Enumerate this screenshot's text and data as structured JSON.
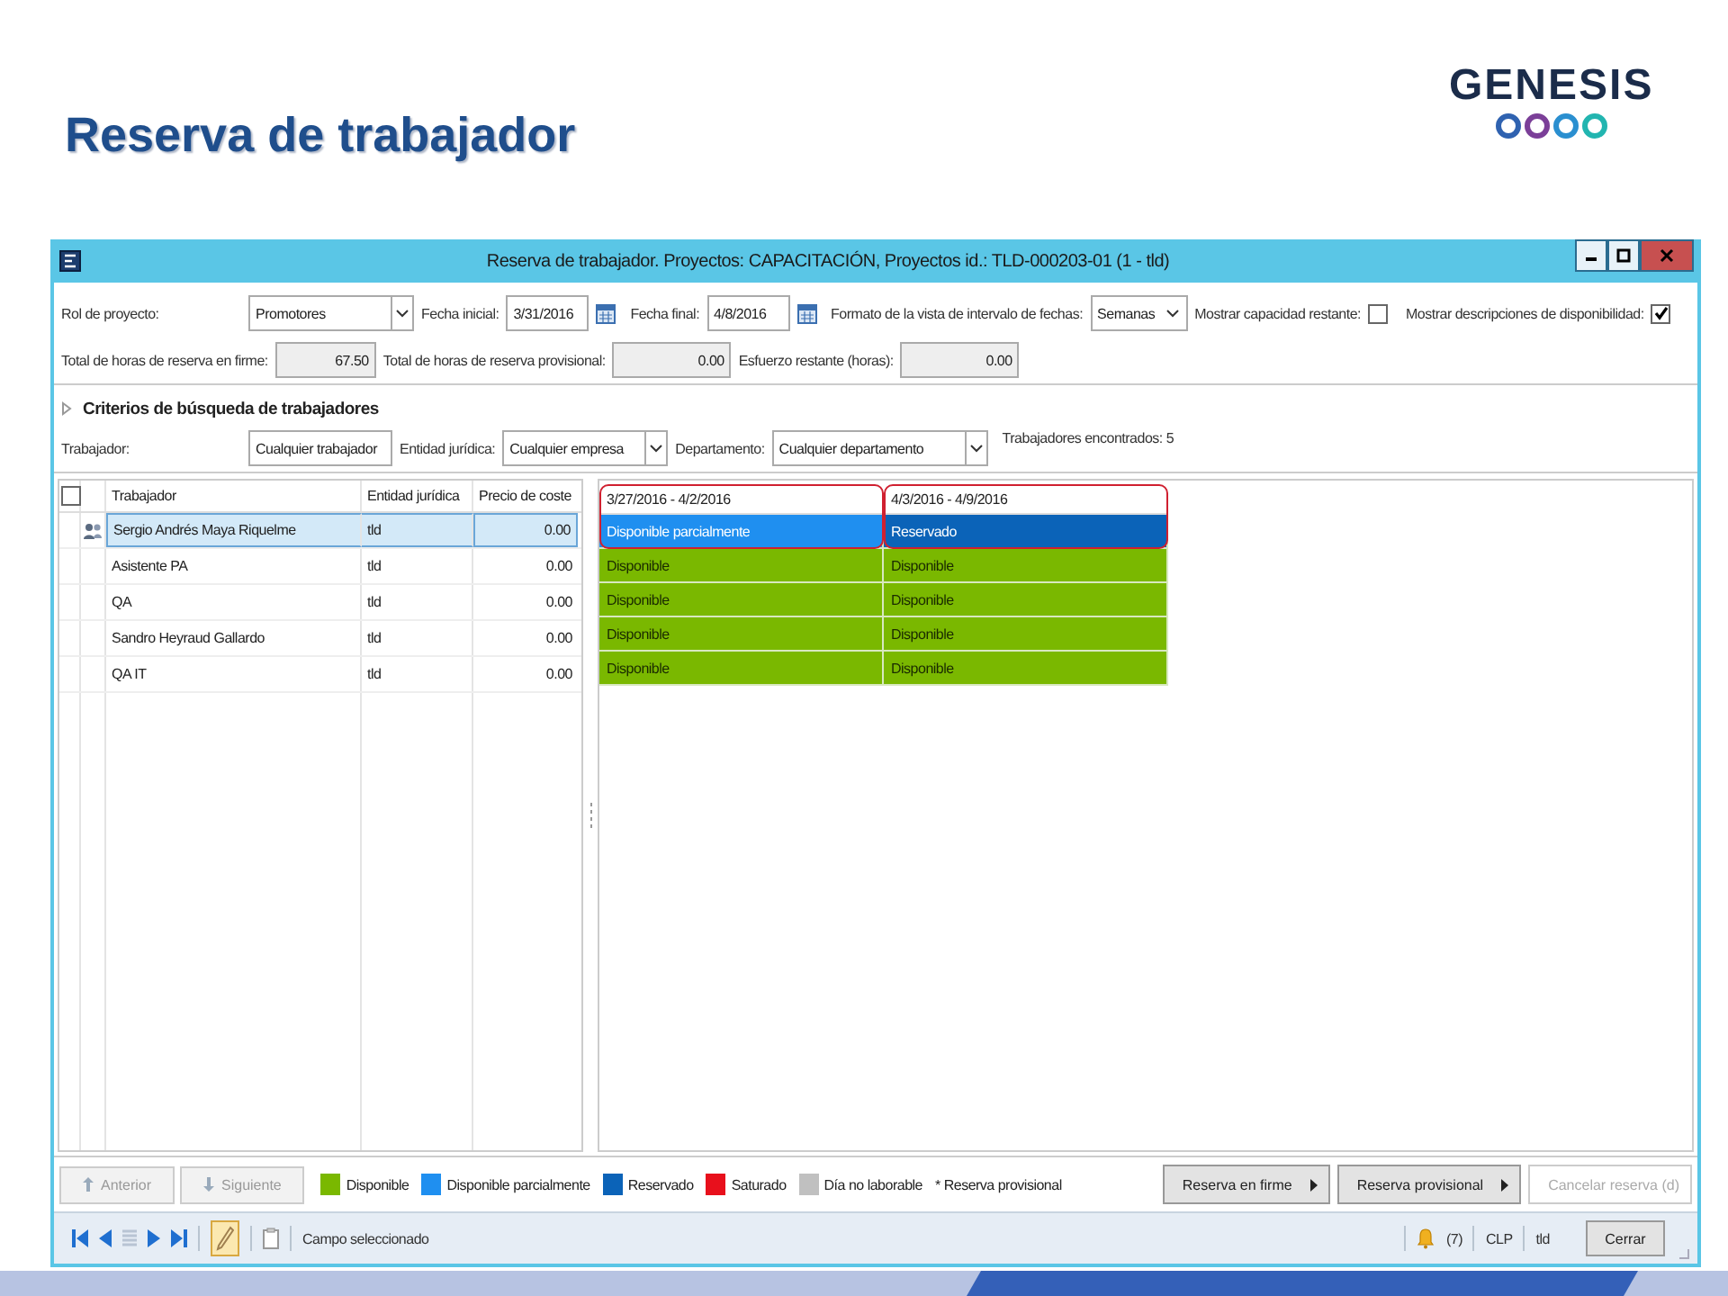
{
  "slide": {
    "title": "Reserva de trabajador",
    "logo": "GENESIS"
  },
  "window": {
    "title": "Reserva de trabajador. Proyectos: CAPACITACIÓN, Proyectos id.: TLD-000203-01 (1 - tld)"
  },
  "form": {
    "rol_proyecto": {
      "label": "Rol de proyecto:",
      "value": "Promotores"
    },
    "fecha_inicial": {
      "label": "Fecha inicial:",
      "value": "3/31/2016"
    },
    "fecha_final": {
      "label": "Fecha final:",
      "value": "4/8/2016"
    },
    "formato": {
      "label": "Formato de la vista de intervalo de fechas:",
      "value": "Semanas"
    },
    "checkboxes": [
      {
        "label": "Mostrar capacidad restante:",
        "checked": false
      },
      {
        "label": "Mostrar descripciones de disponibilidad:",
        "checked": true
      }
    ],
    "totals": [
      {
        "label": "Total de horas de reserva en firme:",
        "value": "67.50"
      },
      {
        "label": "Total de horas de reserva provisional:",
        "value": "0.00"
      },
      {
        "label": "Esfuerzo restante (horas):",
        "value": "0.00"
      }
    ]
  },
  "criteria": {
    "title": "Criterios de búsqueda de trabajadores",
    "trabajador": {
      "label": "Trabajador:",
      "value": "Cualquier trabajador"
    },
    "entidad": {
      "label": "Entidad jurídica:",
      "value": "Cualquier empresa"
    },
    "departamento": {
      "label": "Departamento:",
      "value": "Cualquier departamento"
    },
    "found": "Trabajadores encontrados: 5"
  },
  "workers": {
    "all_selected": false,
    "columns": [
      "Trabajador",
      "Entidad jurídica",
      "Precio de coste"
    ],
    "rows": [
      {
        "name": "Sergio Andrés Maya Riquelme",
        "entity": "tld",
        "cost": "0.00",
        "selected": true
      },
      {
        "name": "Asistente PA",
        "entity": "tld",
        "cost": "0.00",
        "selected": false
      },
      {
        "name": "QA",
        "entity": "tld",
        "cost": "0.00",
        "selected": false
      },
      {
        "name": "Sandro Heyraud Gallardo",
        "entity": "tld",
        "cost": "0.00",
        "selected": false
      },
      {
        "name": "QA IT",
        "entity": "tld",
        "cost": "0.00",
        "selected": false
      }
    ]
  },
  "schedule": {
    "weeks": [
      {
        "label": "3/27/2016 - 4/2/2016",
        "highlighted": true
      },
      {
        "label": "4/3/2016 - 4/9/2016",
        "highlighted": true
      }
    ],
    "rows": [
      [
        {
          "text": "Disponible parcialmente",
          "color": "#1f8ff0"
        },
        {
          "text": "Reservado",
          "color": "#0b63b8"
        }
      ],
      [
        {
          "text": "Disponible",
          "color": "#7ab800"
        },
        {
          "text": "Disponible",
          "color": "#7ab800"
        }
      ],
      [
        {
          "text": "Disponible",
          "color": "#7ab800"
        },
        {
          "text": "Disponible",
          "color": "#7ab800"
        }
      ],
      [
        {
          "text": "Disponible",
          "color": "#7ab800"
        },
        {
          "text": "Disponible",
          "color": "#7ab800"
        }
      ],
      [
        {
          "text": "Disponible",
          "color": "#7ab800"
        },
        {
          "text": "Disponible",
          "color": "#7ab800"
        }
      ]
    ]
  },
  "nav_buttons": [
    {
      "label": "Anterior",
      "kind": "up",
      "disabled": true
    },
    {
      "label": "Siguiente",
      "kind": "down",
      "disabled": true
    }
  ],
  "legend": [
    {
      "label": "Disponible",
      "color": "#7ab800"
    },
    {
      "label": "Disponible parcialmente",
      "color": "#1f8ff0"
    },
    {
      "label": "Reservado",
      "color": "#0b63b8"
    },
    {
      "label": "Saturado",
      "color": "#e8101c"
    },
    {
      "label": "Día no laborable",
      "color": "#c0c0c0"
    }
  ],
  "legend_note": "* Reserva provisional",
  "actions": [
    {
      "label": "Reserva en firme",
      "menu": true,
      "disabled": false
    },
    {
      "label": "Reserva provisional",
      "menu": true,
      "disabled": false
    },
    {
      "label": "Cancelar reserva (d)",
      "menu": false,
      "disabled": true
    }
  ],
  "status_bar": {
    "field": "Campo seleccionado",
    "alerts": "(7)",
    "currency": "CLP",
    "company": "tld",
    "close": "Cerrar"
  }
}
